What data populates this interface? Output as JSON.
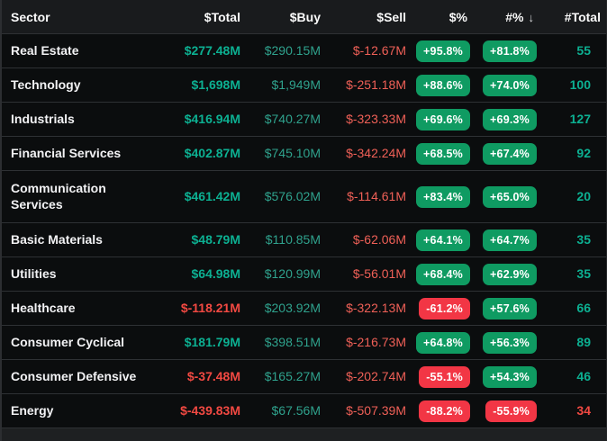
{
  "table": {
    "sort_icon": "↓",
    "columns": [
      {
        "label": "Sector"
      },
      {
        "label": "$Total"
      },
      {
        "label": "$Buy"
      },
      {
        "label": "$Sell"
      },
      {
        "label": "$%"
      },
      {
        "label": "#%"
      },
      {
        "label": "#Total"
      }
    ],
    "rows": [
      {
        "sector": "Real Estate",
        "total": "$277.48M",
        "total_neg": false,
        "buy": "$290.15M",
        "sell": "$-12.67M",
        "pct_dollar": "+95.8%",
        "pct_dollar_neg": false,
        "pct_count": "+81.8%",
        "pct_count_neg": false,
        "count_total": "55",
        "count_neg": false,
        "tall": false
      },
      {
        "sector": "Technology",
        "total": "$1,698M",
        "total_neg": false,
        "buy": "$1,949M",
        "sell": "$-251.18M",
        "pct_dollar": "+88.6%",
        "pct_dollar_neg": false,
        "pct_count": "+74.0%",
        "pct_count_neg": false,
        "count_total": "100",
        "count_neg": false,
        "tall": false
      },
      {
        "sector": "Industrials",
        "total": "$416.94M",
        "total_neg": false,
        "buy": "$740.27M",
        "sell": "$-323.33M",
        "pct_dollar": "+69.6%",
        "pct_dollar_neg": false,
        "pct_count": "+69.3%",
        "pct_count_neg": false,
        "count_total": "127",
        "count_neg": false,
        "tall": false
      },
      {
        "sector": "Financial Services",
        "total": "$402.87M",
        "total_neg": false,
        "buy": "$745.10M",
        "sell": "$-342.24M",
        "pct_dollar": "+68.5%",
        "pct_dollar_neg": false,
        "pct_count": "+67.4%",
        "pct_count_neg": false,
        "count_total": "92",
        "count_neg": false,
        "tall": false
      },
      {
        "sector": "Communication Services",
        "total": "$461.42M",
        "total_neg": false,
        "buy": "$576.02M",
        "sell": "$-114.61M",
        "pct_dollar": "+83.4%",
        "pct_dollar_neg": false,
        "pct_count": "+65.0%",
        "pct_count_neg": false,
        "count_total": "20",
        "count_neg": false,
        "tall": true
      },
      {
        "sector": "Basic Materials",
        "total": "$48.79M",
        "total_neg": false,
        "buy": "$110.85M",
        "sell": "$-62.06M",
        "pct_dollar": "+64.1%",
        "pct_dollar_neg": false,
        "pct_count": "+64.7%",
        "pct_count_neg": false,
        "count_total": "35",
        "count_neg": false,
        "tall": false
      },
      {
        "sector": "Utilities",
        "total": "$64.98M",
        "total_neg": false,
        "buy": "$120.99M",
        "sell": "$-56.01M",
        "pct_dollar": "+68.4%",
        "pct_dollar_neg": false,
        "pct_count": "+62.9%",
        "pct_count_neg": false,
        "count_total": "35",
        "count_neg": false,
        "tall": false
      },
      {
        "sector": "Healthcare",
        "total": "$-118.21M",
        "total_neg": true,
        "buy": "$203.92M",
        "sell": "$-322.13M",
        "pct_dollar": "-61.2%",
        "pct_dollar_neg": true,
        "pct_count": "+57.6%",
        "pct_count_neg": false,
        "count_total": "66",
        "count_neg": false,
        "tall": false
      },
      {
        "sector": "Consumer Cyclical",
        "total": "$181.79M",
        "total_neg": false,
        "buy": "$398.51M",
        "sell": "$-216.73M",
        "pct_dollar": "+64.8%",
        "pct_dollar_neg": false,
        "pct_count": "+56.3%",
        "pct_count_neg": false,
        "count_total": "89",
        "count_neg": false,
        "tall": false
      },
      {
        "sector": "Consumer Defensive",
        "total": "$-37.48M",
        "total_neg": true,
        "buy": "$165.27M",
        "sell": "$-202.74M",
        "pct_dollar": "-55.1%",
        "pct_dollar_neg": true,
        "pct_count": "+54.3%",
        "pct_count_neg": false,
        "count_total": "46",
        "count_neg": false,
        "tall": false
      },
      {
        "sector": "Energy",
        "total": "$-439.83M",
        "total_neg": true,
        "buy": "$67.56M",
        "sell": "$-507.39M",
        "pct_dollar": "-88.2%",
        "pct_dollar_neg": true,
        "pct_count": "-55.9%",
        "pct_count_neg": true,
        "count_total": "34",
        "count_neg": true,
        "tall": false
      }
    ]
  },
  "colors": {
    "row_bg": "#0b0d0e",
    "header_bg": "#191b1d",
    "separator": "#2e3134",
    "positive_teal": "#0cb092",
    "buy_teal_dim": "#2fa28d",
    "negative_red_bold": "#f24942",
    "sell_red_soft": "#ef6057",
    "badge_green": "#0f9b62",
    "badge_red": "#f23645",
    "badge_text": "#ffffff"
  }
}
